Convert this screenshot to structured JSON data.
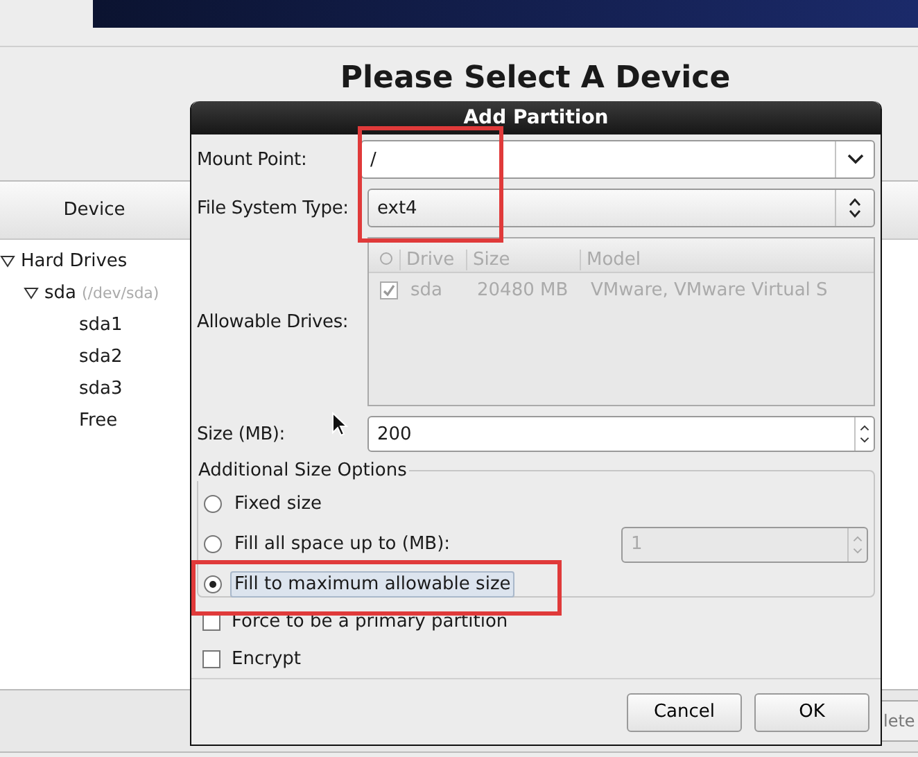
{
  "background": {
    "heading": "Please Select A Device",
    "device_column": "Device",
    "tree": [
      {
        "label": "Hard Drives",
        "expanded": true,
        "children": [
          {
            "label": "sda",
            "detail": "(/dev/sda)",
            "expanded": true,
            "children": [
              {
                "label": "sda1"
              },
              {
                "label": "sda2"
              },
              {
                "label": "sda3"
              },
              {
                "label": "Free"
              }
            ]
          }
        ]
      }
    ],
    "partial_button": "lete"
  },
  "dialog": {
    "title": "Add Partition",
    "mount_point": {
      "label": "Mount Point:",
      "value": "/"
    },
    "file_system": {
      "label": "File System Type:",
      "value": "ext4"
    },
    "drives": {
      "label": "Allowable Drives:",
      "disabled": true,
      "columns": [
        "Drive",
        "Size",
        "Model"
      ],
      "rows": [
        {
          "checked": true,
          "cells": [
            "sda",
            "20480 MB",
            "VMware, VMware Virtual S"
          ]
        }
      ]
    },
    "size": {
      "label": "Size (MB):",
      "value": "200"
    },
    "size_options": {
      "title": "Additional Size Options",
      "options": [
        {
          "label": "Fixed size",
          "selected": false
        },
        {
          "label": "Fill all space up to (MB):",
          "selected": false,
          "spin": {
            "value": "1",
            "disabled": true
          }
        },
        {
          "label": "Fill to maximum allowable size",
          "selected": true
        }
      ]
    },
    "checks": [
      {
        "label": "Force to be a primary partition",
        "checked": false
      },
      {
        "label": "Encrypt",
        "checked": false
      }
    ],
    "buttons": [
      "Cancel",
      "OK"
    ]
  }
}
